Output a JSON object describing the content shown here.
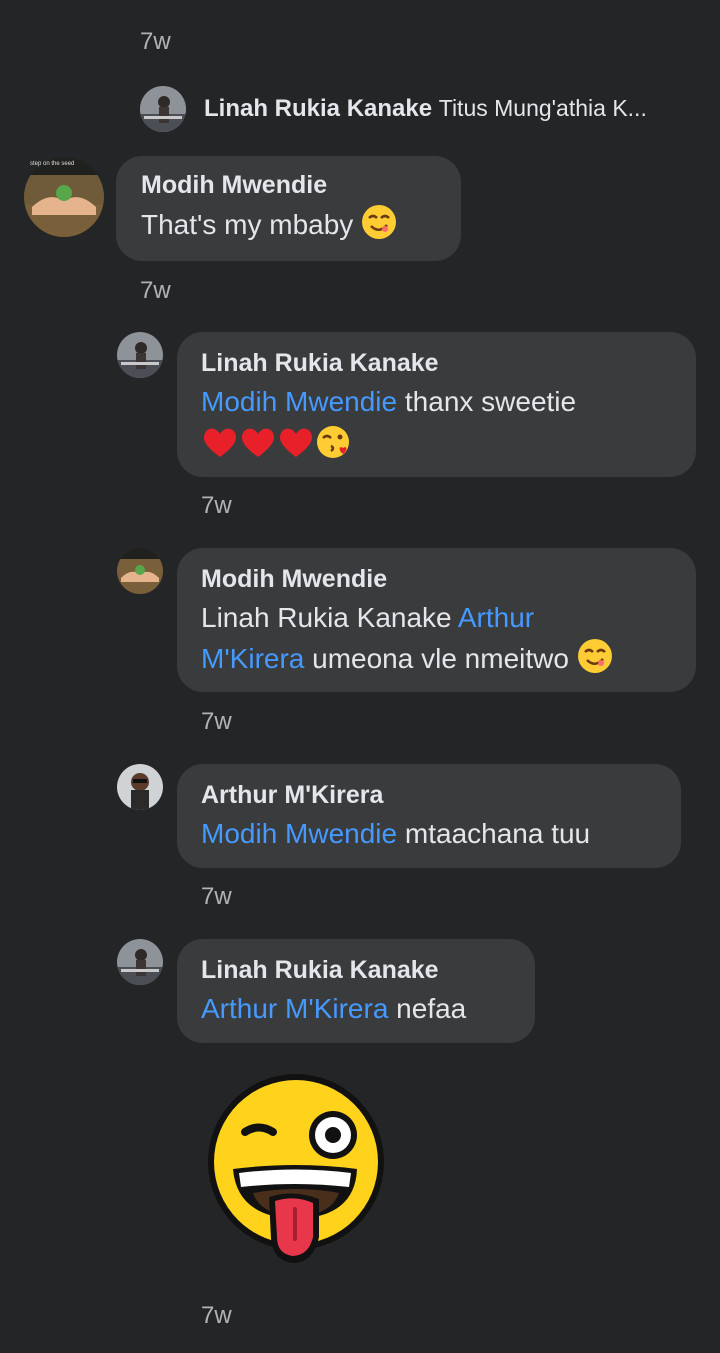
{
  "top_time": "7w",
  "collapsed_reply": {
    "author": "Linah Rukia Kanake",
    "preview": "Titus Mung'athia K..."
  },
  "comment_main": {
    "author": "Modih Mwendie",
    "text": "That's my mbaby",
    "emoji": "smirk-emoji",
    "time": "7w",
    "avatar_caption": "step on the seed"
  },
  "replies": [
    {
      "author": "Linah Rukia Kanake",
      "mention": "Modih Mwendie",
      "text": " thanx sweetie",
      "emoji_line": [
        "heart-emoji",
        "heart-emoji",
        "heart-emoji",
        "kiss-emoji"
      ],
      "time": "7w"
    },
    {
      "author": "Modih Mwendie",
      "prefix": "Linah Rukia Kanake ",
      "mention_line1": "Arthur",
      "mention_line2": "M'Kirera",
      "text": " umeona vle nmeitwo",
      "emoji": "smirk-emoji",
      "time": "7w"
    },
    {
      "author": "Arthur M'Kirera",
      "mention": "Modih Mwendie",
      "text": " mtaachana tuu",
      "time": "7w"
    },
    {
      "author": "Linah Rukia Kanake",
      "mention": "Arthur M'Kirera",
      "text": " nefaa",
      "sticker": "winking-tongue-sticker",
      "time": "7w"
    }
  ],
  "colors": {
    "background": "#242526",
    "bubble": "#3a3b3c",
    "mention": "#4599ff",
    "muted": "#b0b3b8"
  }
}
